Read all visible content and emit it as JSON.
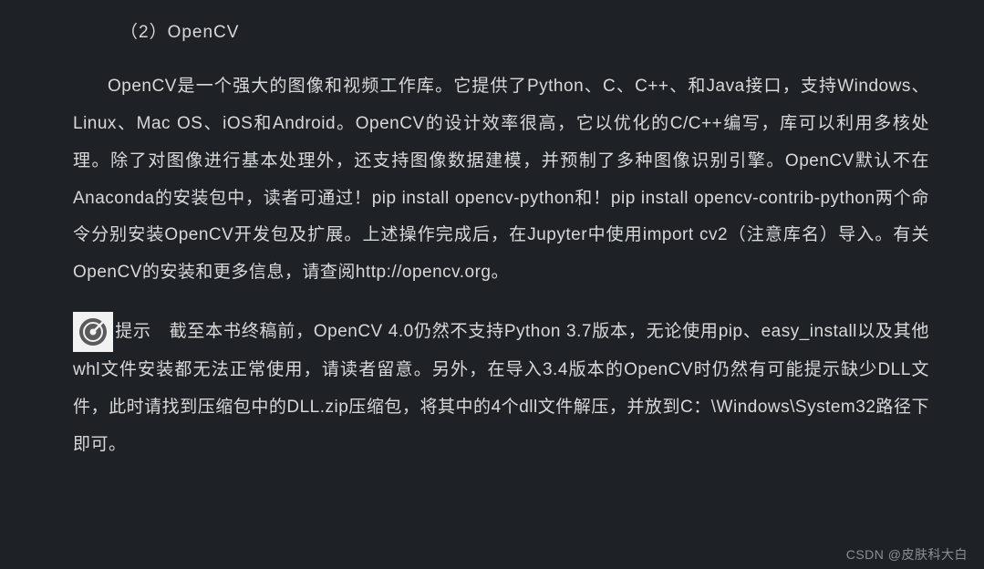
{
  "heading": "（2）OpenCV",
  "paragraph1": "OpenCV是一个强大的图像和视频工作库。它提供了Python、C、C++、和Java接口，支持Windows、Linux、Mac OS、iOS和Android。OpenCV的设计效率很高，它以优化的C/C++编写，库可以利用多核处理。除了对图像进行基本处理外，还支持图像数据建模，并预制了多种图像识别引擎。OpenCV默认不在Anaconda的安装包中，读者可通过！pip install opencv-python和！pip install opencv-contrib-python两个命令分别安装OpenCV开发包及扩展。上述操作完成后，在Jupyter中使用import cv2（注意库名）导入。有关OpenCV的安装和更多信息，请查阅http://opencv.org。",
  "tip_label": "提示",
  "paragraph2": "　截至本书终稿前，OpenCV 4.0仍然不支持Python 3.7版本，无论使用pip、easy_install以及其他whl文件安装都无法正常使用，请读者留意。另外，在导入3.4版本的OpenCV时仍然有可能提示缺少DLL文件，此时请找到压缩包中的DLL.zip压缩包，将其中的4个dll文件解压，并放到C：\\Windows\\System32路径下即可。",
  "watermark": "CSDN @皮肤科大白"
}
